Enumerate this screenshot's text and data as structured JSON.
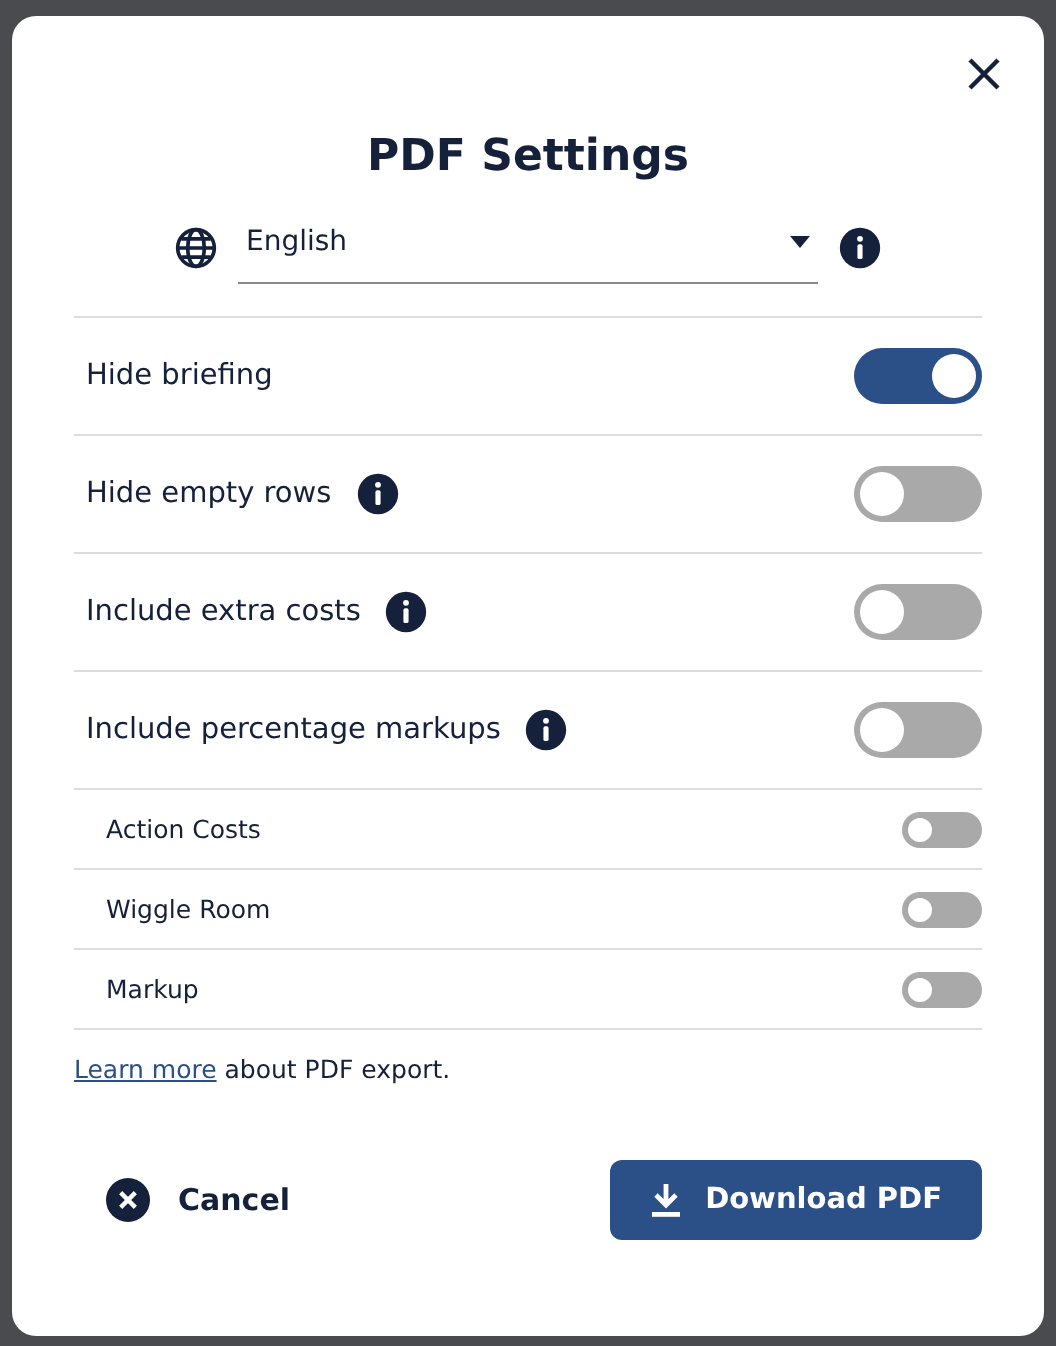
{
  "dialog": {
    "title": "PDF Settings"
  },
  "language": {
    "value": "English"
  },
  "options": [
    {
      "kind": "main",
      "label": "Hide briefing",
      "info": false,
      "on": true
    },
    {
      "kind": "main",
      "label": "Hide empty rows",
      "info": true,
      "on": false
    },
    {
      "kind": "main",
      "label": "Include extra costs",
      "info": true,
      "on": false
    },
    {
      "kind": "main",
      "label": "Include percentage markups",
      "info": true,
      "on": false
    },
    {
      "kind": "sub",
      "label": "Action Costs",
      "info": false,
      "on": false
    },
    {
      "kind": "sub",
      "label": "Wiggle Room",
      "info": false,
      "on": false
    },
    {
      "kind": "sub",
      "label": "Markup",
      "info": false,
      "on": false
    }
  ],
  "note": {
    "link": "Learn more",
    "text": " about PDF export."
  },
  "buttons": {
    "cancel": "Cancel",
    "download": "Download PDF"
  }
}
